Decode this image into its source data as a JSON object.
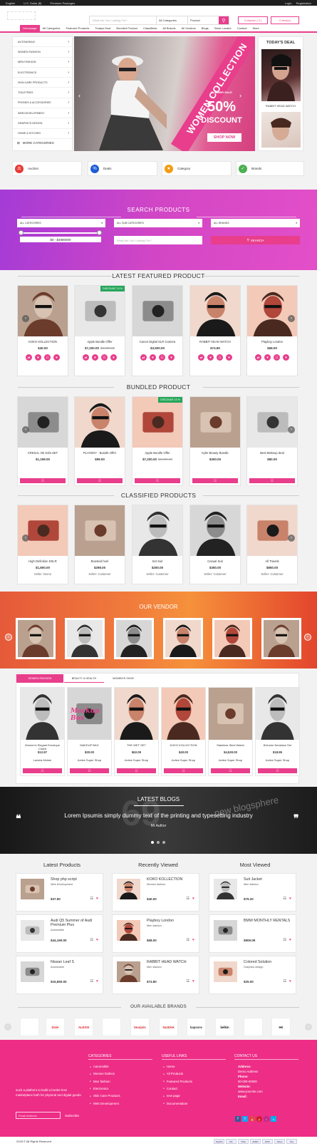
{
  "topbar": {
    "language": "English",
    "currency": "U.S. Dollar ($)",
    "premium": "Premium Packages",
    "login": "Login",
    "register": "Registration"
  },
  "header": {
    "search_placeholder": "What Are You Looking For?",
    "category_select": "All Categories",
    "type_select": "Product",
    "compare": "Compare ( 0 )",
    "cart": "0 item(s)"
  },
  "nav": [
    "Homepage",
    "All Categories",
    "Featured Products",
    "Todays Deal",
    "Bundled Product",
    "Classifieds",
    "All Brands",
    "All Vendors",
    "Blogs",
    "Store Locator",
    "Contact",
    "More"
  ],
  "categories": [
    "AUTOMOBILE",
    "WOMEN FASHION",
    "MEN FASHION",
    "ELECTRONICS",
    "SKIN CARE PRODUCTS",
    "TOILETRIES",
    "PHONES & ACCESSORIES",
    "WEB DEVELOPMENT",
    "GRAPHICS DESIGN",
    "HOME & KITCHEN"
  ],
  "more_categories": "MORE CATEGORIES",
  "hero": {
    "banner": "WOMEN COLLECTION",
    "sale": "SUMMER SALE",
    "percent": "50%",
    "discount": "DISCOUNT",
    "cta": "SHOP NOW"
  },
  "todays_deal": {
    "title": "TODAY'S DEAL",
    "item": "RABBIT HEAD WATCH"
  },
  "features": [
    "Auction",
    "Deals",
    "Category",
    "Brands"
  ],
  "colors": {
    "accent": "#e83e8c",
    "discount_badge": "#26a65b",
    "footer": "#ed2d86"
  },
  "search_products": {
    "title": "SEARCH PRODUCTS",
    "all_categories": "ALL CATEGORIES",
    "all_sub": "ALL SUB CATEGORIES",
    "all_brands": "ALL BRANDS",
    "price_range": "$0 - $4880000",
    "placeholder": "What Are You Looking For?",
    "button": "SEARCH"
  },
  "featured": {
    "title": "LATEST FEATURED PRODUCT",
    "items": [
      {
        "name": "KOKO KOLLECTION",
        "price": "$40.00",
        "old": ""
      },
      {
        "name": "Apple Bundle Offer",
        "price": "$7,200.00",
        "old": "$8,000.00",
        "badge": "DISCOUNT 10 %"
      },
      {
        "name": "Canon Digital SLR Camera",
        "price": "$3,500.00",
        "old": ""
      },
      {
        "name": "RABBIT HEAD WATCH",
        "price": "$74.80",
        "old": ""
      },
      {
        "name": "Playboy London",
        "price": "$68.00",
        "old": ""
      }
    ]
  },
  "bundled": {
    "title": "BUNDLED PRODUCT",
    "items": [
      {
        "name": "CRESAL Ink Sofa SET",
        "price": "$1,199.00",
        "old": ""
      },
      {
        "name": "PLAYBOY - Bundle Offer",
        "price": "$99.00",
        "old": ""
      },
      {
        "name": "Apple Bundle Offer",
        "price": "$7,200.00",
        "old": "$8,000.00",
        "badge": "DISCOUNT 10 %"
      },
      {
        "name": "Kylie Beauty Bundle",
        "price": "$300.00",
        "old": ""
      },
      {
        "name": "Best Makeup deal",
        "price": "$80.00",
        "old": ""
      }
    ]
  },
  "classified": {
    "title": "CLASSIFIED PRODUCTS",
    "items": [
      {
        "name": "High Definition DSLR",
        "price": "$1,800.00",
        "seller": "Seller: Demo"
      },
      {
        "name": "Boosted heel",
        "price": "$298.00",
        "seller": "Seller: Customer"
      },
      {
        "name": "Set Suit",
        "price": "$250.00",
        "seller": "Seller: Customer"
      },
      {
        "name": "Casual Suit",
        "price": "$350.00",
        "seller": "Seller: Customer"
      },
      {
        "name": "All Travels",
        "price": "$850.00",
        "seller": "Seller: Customer"
      }
    ]
  },
  "vendor": {
    "title": "OUR VENDOR"
  },
  "tabs": {
    "labels": [
      "WOMEN FASHION",
      "BEAUTY & HEALTH",
      "WOMEN'S SHOE"
    ],
    "items": [
      {
        "name": "Women's Elegant Envelope Clutch",
        "price": "$12.97",
        "vendor": "Lavinia Mckee"
      },
      {
        "name": "MAKEUP BAG",
        "price": "$30.00",
        "vendor": "Active Super Shop",
        "label": "Mackup Box"
      },
      {
        "name": "THE WET SET",
        "price": "$62.09",
        "vendor": "Active Super Shop"
      },
      {
        "name": "KOKO KOLLECTION",
        "price": "$40.00",
        "vendor": "Active Super Shop"
      },
      {
        "name": "Stainless Steel Watch",
        "price": "$4,530.00",
        "vendor": "Active Super Shop"
      },
      {
        "name": "BriLizee Necklace Set",
        "price": "$18.95",
        "vendor": "Active Super Shop"
      }
    ]
  },
  "blogs": {
    "title": "LATEST BLOGS",
    "text": "Lorem Ipsumis simply dummy text of the printing and typesetting industry",
    "author": "Mr Author",
    "bg_word": "new blogsphere"
  },
  "lists": {
    "latest": {
      "title": "Latest Products",
      "items": [
        {
          "name": "Shop php script",
          "cat": "Web Development",
          "price": "$37.50"
        },
        {
          "name": "Audi Q5 Summer of Audi Premium Plus",
          "cat": "Automobile",
          "price": "$44,190.00"
        },
        {
          "name": "Nissan Leaf S",
          "cat": "Automobile",
          "price": "$15,550.00"
        }
      ]
    },
    "recent": {
      "title": "Recently Viewed",
      "items": [
        {
          "name": "KOKO KOLLECTION",
          "cat": "Women fashion",
          "price": "$40.00"
        },
        {
          "name": "Playboy London",
          "cat": "Men fashion",
          "price": "$68.00"
        },
        {
          "name": "RABBIT HEAD WATCH",
          "cat": "Men fashion",
          "price": "$74.80"
        }
      ]
    },
    "viewed": {
      "title": "Most Viewed",
      "items": [
        {
          "name": "Suit Jacket",
          "cat": "Men fashion",
          "price": "$79.20"
        },
        {
          "name": "BMW MONTHLY RENTALS",
          "cat": "",
          "price": "$909.09"
        },
        {
          "name": "Colored Solution",
          "cat": "Graphics design",
          "price": "$25.00"
        }
      ]
    }
  },
  "brands": {
    "title": "OUR AVAILABLE BRANDS",
    "items": [
      "",
      "Dixie",
      "ALESSI",
      "",
      "bourjois",
      "SanDisk",
      "kapsons",
      "belkin",
      "",
      "HK"
    ]
  },
  "footer": {
    "about": "such a platform to build a border less marketplace both for physical and digital goods.",
    "email_placeholder": "Email Address",
    "subscribe": "Subscribe",
    "categories_title": "CATEGORIES",
    "categories": [
      "Automobile",
      "Women fashion",
      "Men fashion",
      "Electronics",
      "Skin Care Products",
      "Web Development"
    ],
    "links_title": "USEFUL LINKS",
    "links": [
      "Home",
      "All Products",
      "Featured Products",
      "Contact",
      "new page",
      "Documentation"
    ],
    "contact_title": "CONTACT US",
    "address_label": "Address:",
    "address": "Demo Address",
    "phone_label": "Phone:",
    "phone": "00-000-00000",
    "website_label": "Website:",
    "website": "www.yoursite.com",
    "email_label": "Email:",
    "copyright": "2018 © All Rights Reserved",
    "payments": [
      "PayPal",
      "MC",
      "VISA",
      "AMEX",
      "DISC",
      "Stripe",
      "Pay"
    ]
  }
}
